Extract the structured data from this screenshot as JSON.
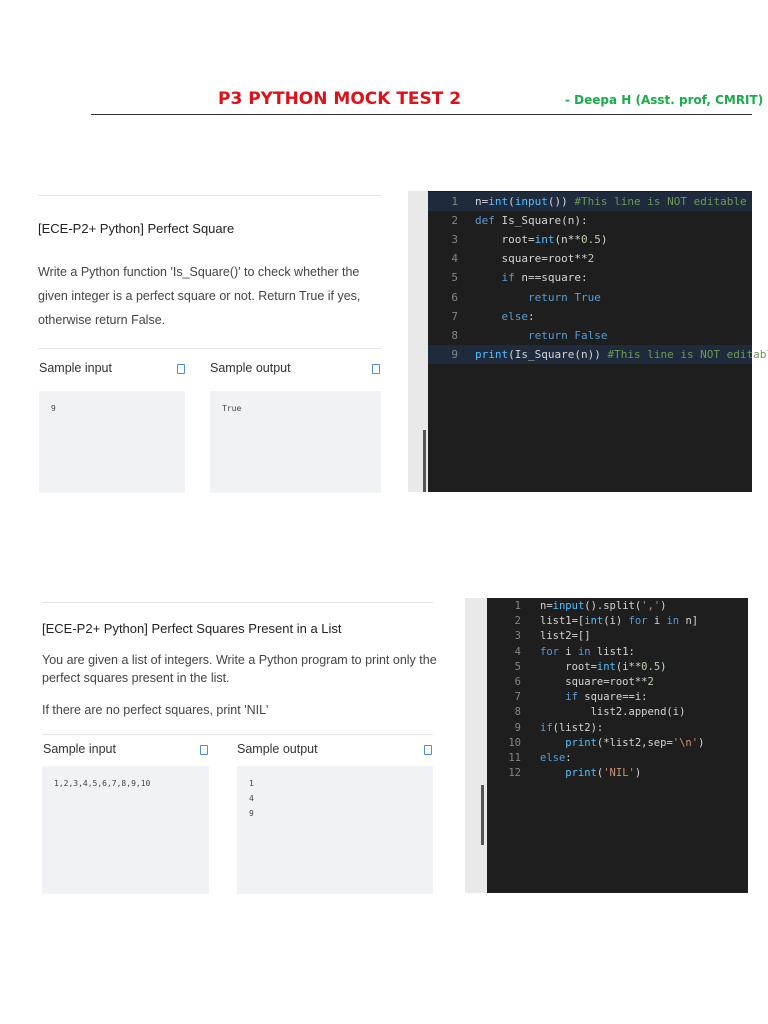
{
  "header": {
    "title": "P3 PYTHON MOCK TEST 2",
    "author": "- Deepa H (Asst. prof, CMRIT)"
  },
  "problems": [
    {
      "title": "[ECE-P2+ Python] Perfect Square",
      "description": [
        "Write a Python function 'Is_Square()' to check whether the given integer is a perfect square or not. Return True if yes, otherwise return False."
      ],
      "sample_input_label": "Sample input",
      "sample_output_label": "Sample output",
      "sample_input": "9",
      "sample_output": "True",
      "code": [
        [
          [
            "n=",
            "tx"
          ],
          [
            "int",
            "fn"
          ],
          [
            "(",
            "tx"
          ],
          [
            "input",
            "fn"
          ],
          [
            "()) ",
            "tx"
          ],
          [
            "#This line is NOT editable",
            "cm"
          ]
        ],
        [
          [
            "def ",
            "kw"
          ],
          [
            "Is_Square(n):",
            "tx"
          ]
        ],
        [
          [
            "    root=",
            "tx"
          ],
          [
            "int",
            "fn"
          ],
          [
            "(n**",
            "tx"
          ],
          [
            "0.5",
            "nm"
          ],
          [
            ")",
            "tx"
          ]
        ],
        [
          [
            "    square=root**",
            "tx"
          ],
          [
            "2",
            "nm"
          ]
        ],
        [
          [
            "    if ",
            "kw"
          ],
          [
            "n==square:",
            "tx"
          ]
        ],
        [
          [
            "        return True",
            "kw"
          ]
        ],
        [
          [
            "    else",
            "kw"
          ],
          [
            ":",
            "tx"
          ]
        ],
        [
          [
            "        return False",
            "kw"
          ]
        ],
        [
          [
            "print",
            "fn"
          ],
          [
            "(Is_Square(n)) ",
            "tx"
          ],
          [
            "#This line is NOT editable",
            "cm"
          ]
        ]
      ]
    },
    {
      "title": "[ECE-P2+ Python] Perfect Squares Present in a List",
      "description": [
        "You are given a list of integers. Write a Python program to print only the perfect squares present in the list.",
        "If there are no perfect squares, print 'NIL'"
      ],
      "sample_input_label": "Sample input",
      "sample_output_label": "Sample output",
      "sample_input": "1,2,3,4,5,6,7,8,9,10",
      "sample_output": "1\n4\n9",
      "code": [
        [
          [
            "n=",
            "tx"
          ],
          [
            "input",
            "fn"
          ],
          [
            "().split(",
            "tx"
          ],
          [
            "','",
            "st"
          ],
          [
            ")",
            "tx"
          ]
        ],
        [
          [
            "list1=[",
            "tx"
          ],
          [
            "int",
            "fn"
          ],
          [
            "(i) ",
            "tx"
          ],
          [
            "for ",
            "kw"
          ],
          [
            "i ",
            "tx"
          ],
          [
            "in ",
            "kw"
          ],
          [
            "n]",
            "tx"
          ]
        ],
        [
          [
            "list2=[]",
            "tx"
          ]
        ],
        [
          [
            "for ",
            "kw"
          ],
          [
            "i ",
            "tx"
          ],
          [
            "in ",
            "kw"
          ],
          [
            "list1:",
            "tx"
          ]
        ],
        [
          [
            "    root=",
            "tx"
          ],
          [
            "int",
            "fn"
          ],
          [
            "(i**",
            "tx"
          ],
          [
            "0.5",
            "nm"
          ],
          [
            ")",
            "tx"
          ]
        ],
        [
          [
            "    square=root**",
            "tx"
          ],
          [
            "2",
            "nm"
          ]
        ],
        [
          [
            "    if ",
            "kw"
          ],
          [
            "square==i:",
            "tx"
          ]
        ],
        [
          [
            "        list2.append(i)",
            "tx"
          ]
        ],
        [
          [
            "if",
            "kw"
          ],
          [
            "(list2):",
            "tx"
          ]
        ],
        [
          [
            "    print",
            "fn"
          ],
          [
            "(*list2,sep=",
            "tx"
          ],
          [
            "'\\n'",
            "st"
          ],
          [
            ")",
            "tx"
          ]
        ],
        [
          [
            "else",
            "kw"
          ],
          [
            ":",
            "tx"
          ]
        ],
        [
          [
            "    print",
            "fn"
          ],
          [
            "(",
            "tx"
          ],
          [
            "'NIL'",
            "st"
          ],
          [
            ")",
            "tx"
          ]
        ]
      ]
    }
  ]
}
